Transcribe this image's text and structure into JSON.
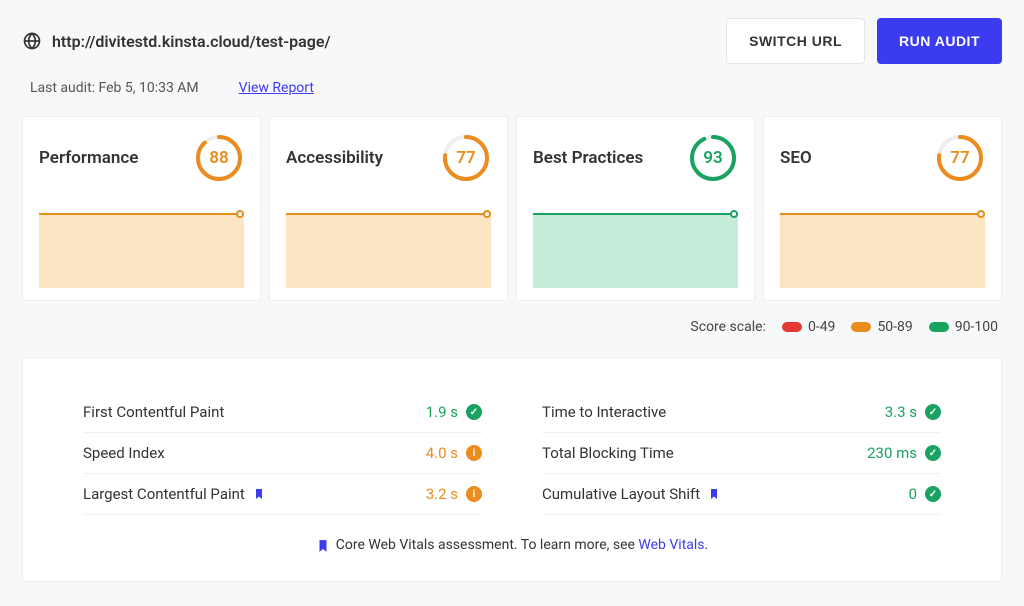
{
  "header": {
    "url": "http://divitestd.kinsta.cloud/test-page/",
    "switch_label": "SWITCH URL",
    "run_label": "RUN AUDIT"
  },
  "subheader": {
    "last_audit": "Last audit: Feb 5, 10:33 AM",
    "view_report": "View Report"
  },
  "cards": [
    {
      "title": "Performance",
      "score": 88,
      "color": "#eb8c1e",
      "tone": "orange"
    },
    {
      "title": "Accessibility",
      "score": 77,
      "color": "#eb8c1e",
      "tone": "orange"
    },
    {
      "title": "Best Practices",
      "score": 93,
      "color": "#1aa260",
      "tone": "green"
    },
    {
      "title": "SEO",
      "score": 77,
      "color": "#eb8c1e",
      "tone": "orange"
    }
  ],
  "scale": {
    "label": "Score scale:",
    "ranges": [
      "0-49",
      "50-89",
      "90-100"
    ]
  },
  "metrics": {
    "left": [
      {
        "label": "First Contentful Paint",
        "value": "1.9 s",
        "valClass": "val-green",
        "status": "green",
        "bookmark": false
      },
      {
        "label": "Speed Index",
        "value": "4.0 s",
        "valClass": "val-orange",
        "status": "orange",
        "bookmark": false
      },
      {
        "label": "Largest Contentful Paint",
        "value": "3.2 s",
        "valClass": "val-orange",
        "status": "orange",
        "bookmark": true
      }
    ],
    "right": [
      {
        "label": "Time to Interactive",
        "value": "3.3 s",
        "valClass": "val-green",
        "status": "green",
        "bookmark": false
      },
      {
        "label": "Total Blocking Time",
        "value": "230 ms",
        "valClass": "val-green",
        "status": "green",
        "bookmark": false
      },
      {
        "label": "Cumulative Layout Shift",
        "value": "0",
        "valClass": "val-green",
        "status": "green",
        "bookmark": true
      }
    ]
  },
  "footer": {
    "text": "Core Web Vitals assessment. To learn more, see ",
    "link": "Web Vitals",
    "suffix": "."
  }
}
